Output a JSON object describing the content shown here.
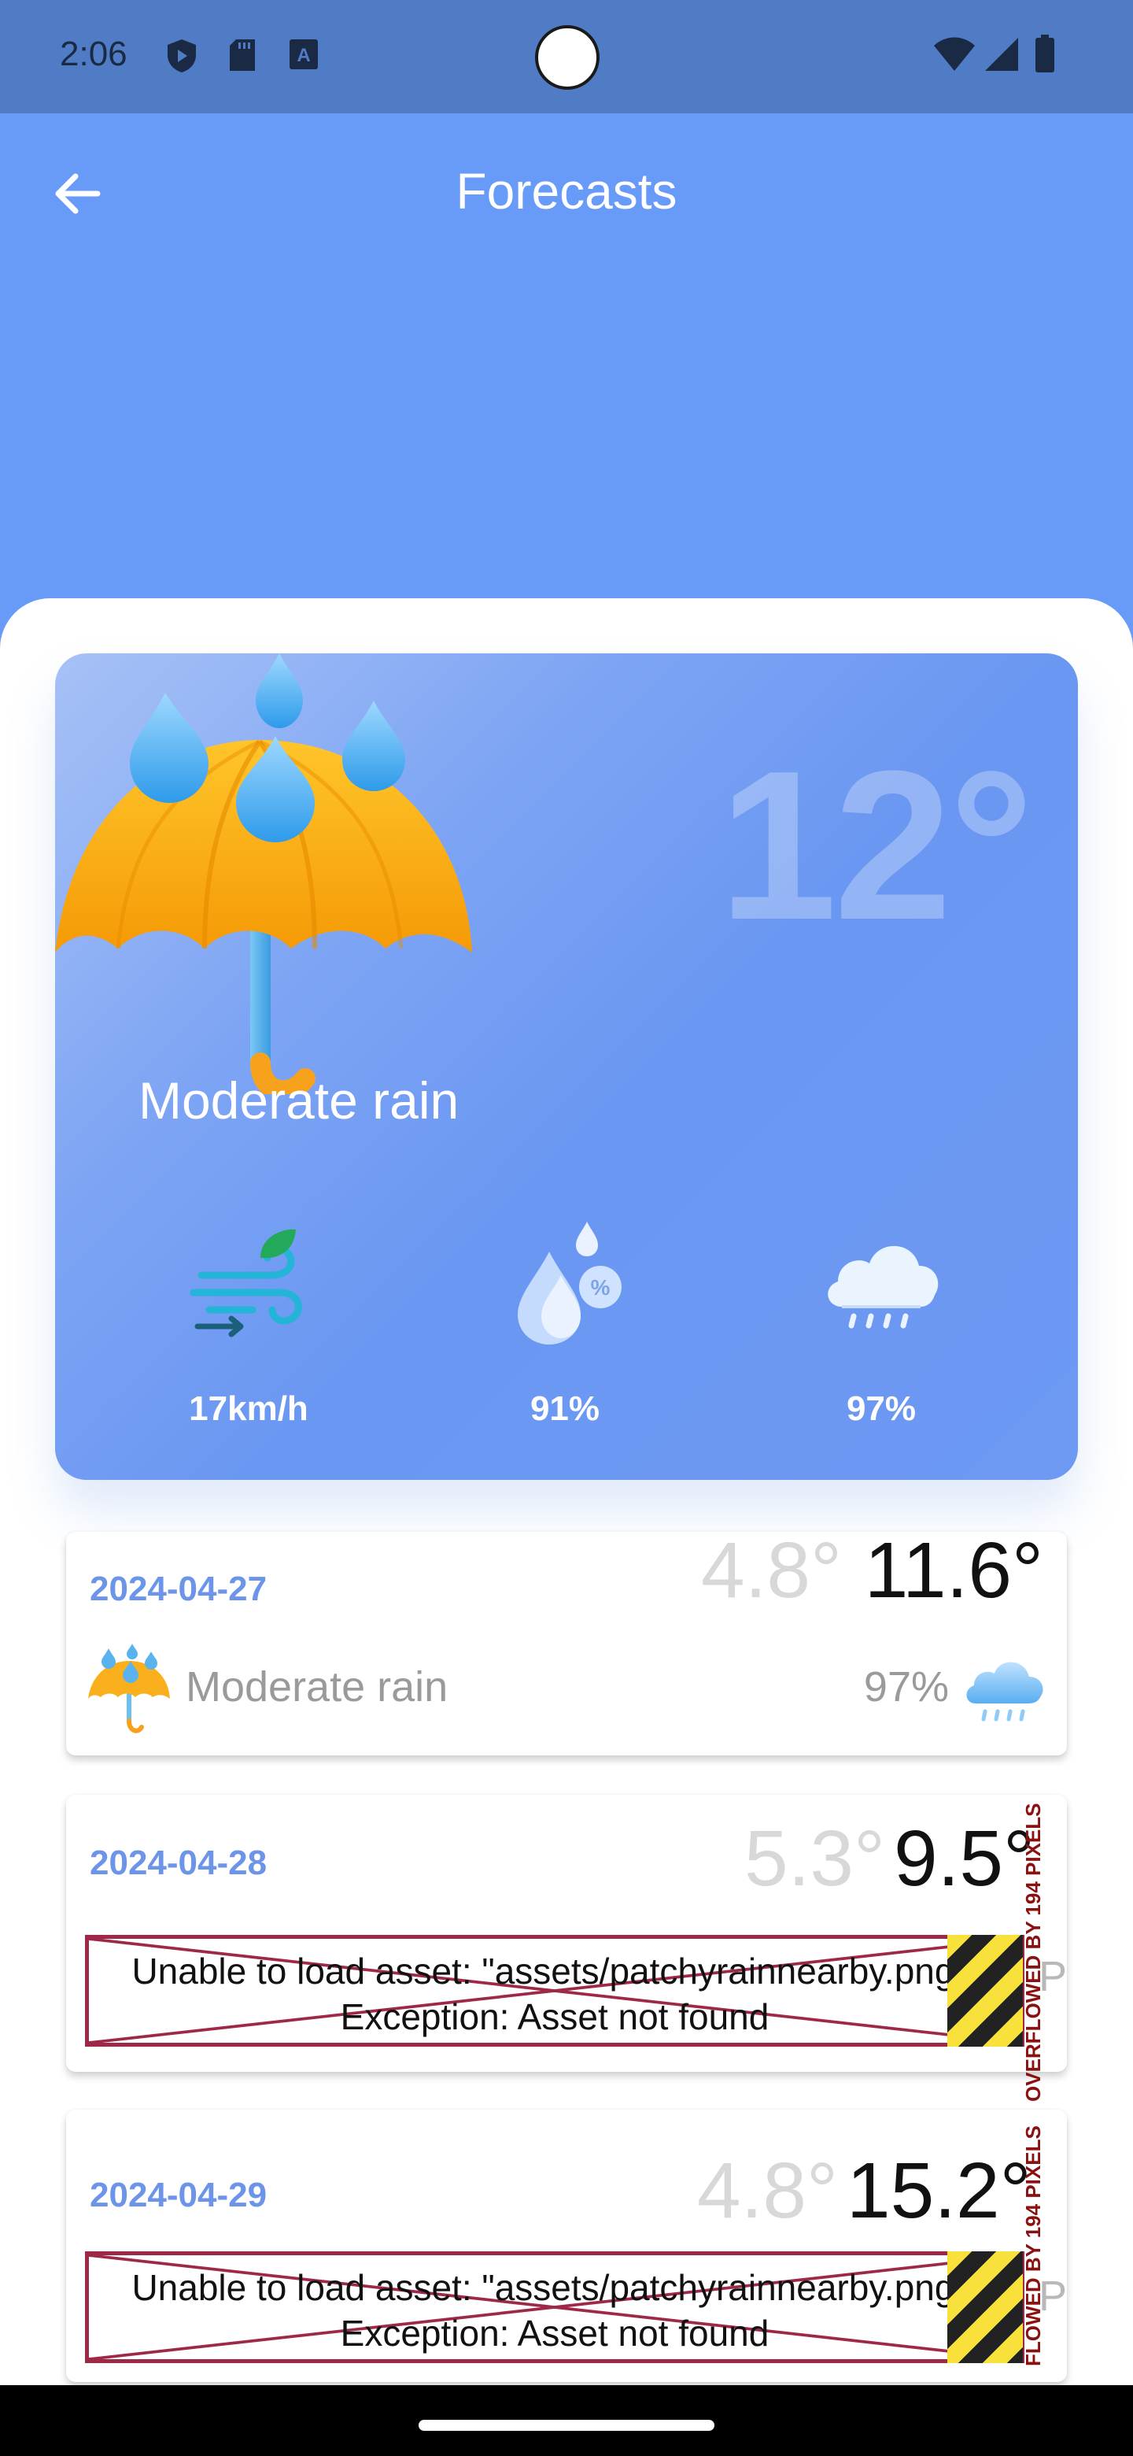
{
  "status_bar": {
    "time": "2:06",
    "icons": [
      "shield-icon",
      "sd-card-icon",
      "keyboard-a-icon",
      "wifi-icon",
      "signal-icon",
      "battery-icon"
    ]
  },
  "app_bar": {
    "title": "Forecasts",
    "back_icon": "arrow-left-icon"
  },
  "current": {
    "temperature": "12°",
    "condition": "Moderate rain",
    "wind": "17km/h",
    "humidity": "91%",
    "rain_chance": "97%",
    "icons": [
      "umbrella-rain-icon",
      "wind-icon",
      "humidity-icon",
      "rain-cloud-icon"
    ]
  },
  "forecasts": [
    {
      "date": "2024-04-27",
      "min": "4.8°",
      "max": "11.6°",
      "condition": "Moderate rain",
      "chance": "97%"
    },
    {
      "date": "2024-04-28",
      "min": "5.3°",
      "max": "9.5°",
      "error_line1": "Unable to load asset: \"assets/patchyrainnearby.png\".",
      "error_line2": "Exception: Asset not found",
      "overflow": "OVERFLOWED BY 194 PIXELS",
      "cut_text": "Pa"
    },
    {
      "date": "2024-04-29",
      "min": "4.8°",
      "max": "15.2°",
      "error_line1": "Unable to load asset: \"assets/patchyrainnearby.png\".",
      "error_line2": "Exception: Asset not found",
      "overflow": "FLOWED BY 194 PIXELS",
      "cut_text": "Pa"
    }
  ],
  "colors": {
    "app_bar": "#689AF8",
    "status_bar": "#507BC5",
    "date": "#6c94e8",
    "error_border": "#9e2946"
  }
}
